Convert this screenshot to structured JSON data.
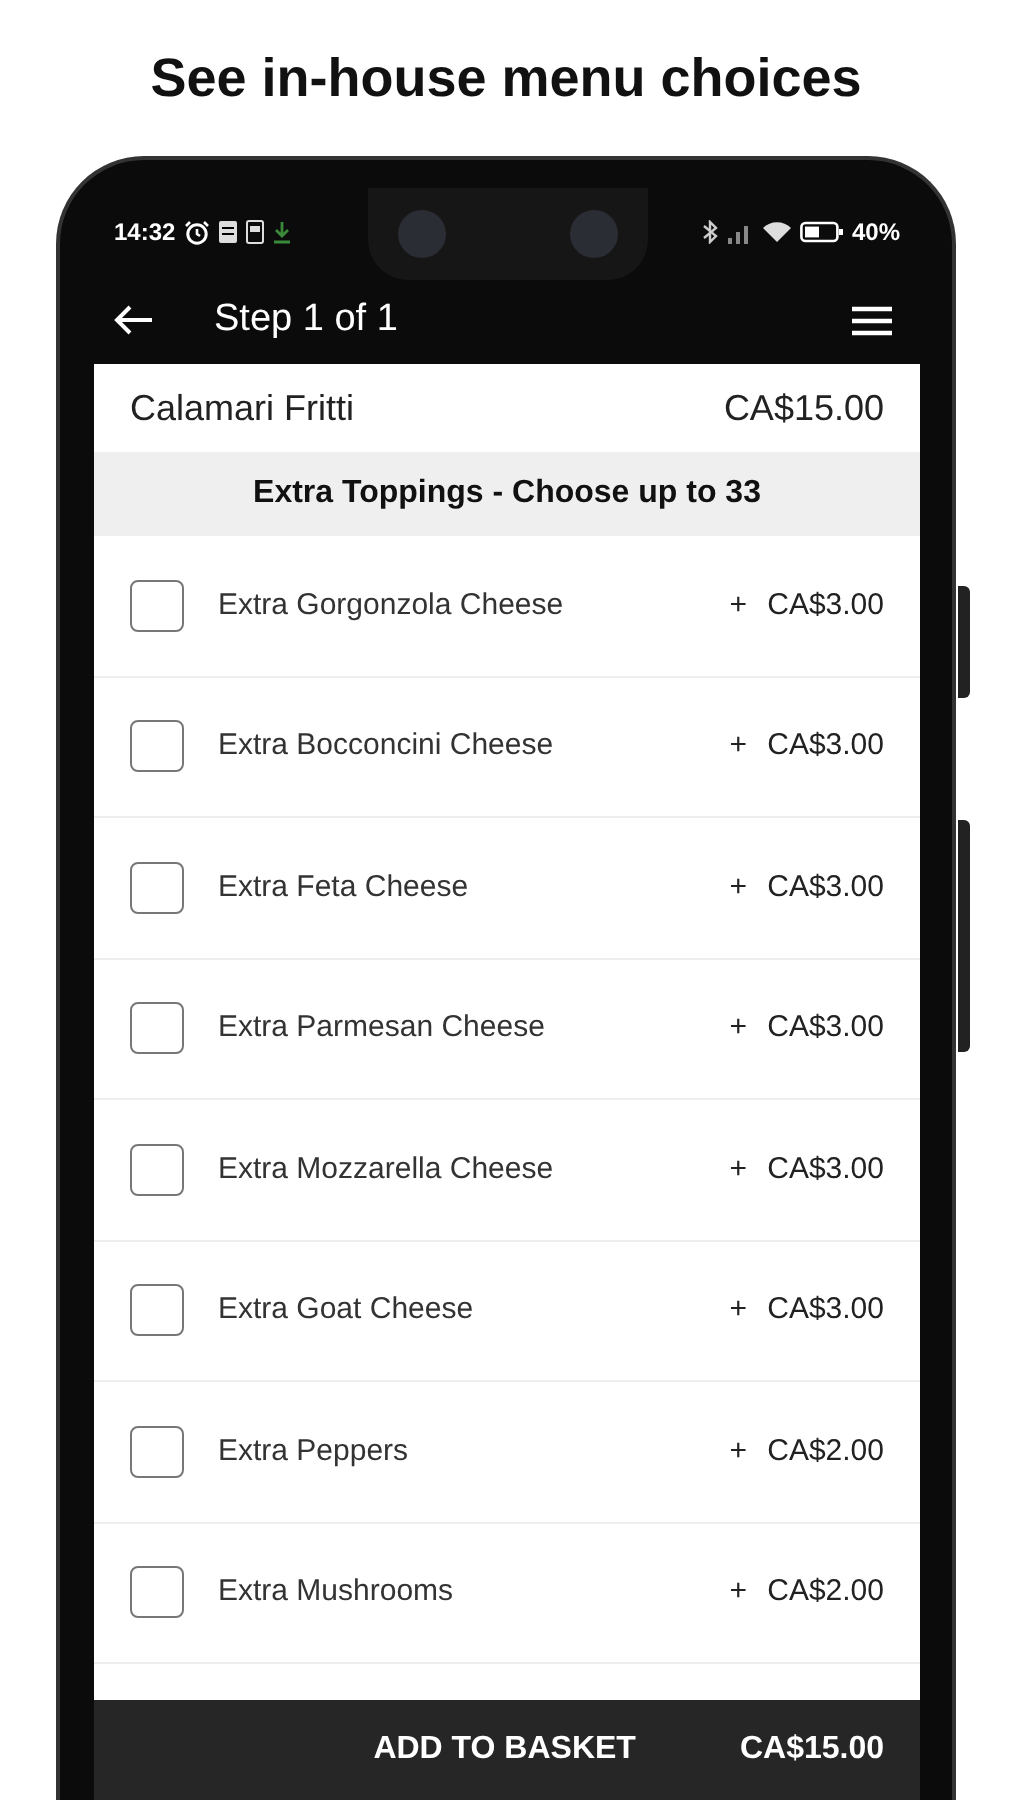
{
  "caption": "See in-house menu choices",
  "status_bar": {
    "time": "14:32",
    "battery": "40%"
  },
  "header": {
    "title": "Step 1 of 1"
  },
  "item": {
    "name": "Calamari Fritti",
    "price": "CA$15.00"
  },
  "section": {
    "title": "Extra Toppings - Choose up to 33"
  },
  "options": [
    {
      "label": "Extra Gorgonzola Cheese",
      "price": "+ CA$3.00",
      "checked": false
    },
    {
      "label": "Extra Bocconcini Cheese",
      "price": "+ CA$3.00",
      "checked": false
    },
    {
      "label": "Extra Feta Cheese",
      "price": "+ CA$3.00",
      "checked": false
    },
    {
      "label": "Extra Parmesan Cheese",
      "price": "+ CA$3.00",
      "checked": false
    },
    {
      "label": "Extra Mozzarella Cheese",
      "price": "+ CA$3.00",
      "checked": false
    },
    {
      "label": "Extra Goat Cheese",
      "price": "+ CA$3.00",
      "checked": false
    },
    {
      "label": "Extra Peppers",
      "price": "+ CA$2.00",
      "checked": false
    },
    {
      "label": "Extra Mushrooms",
      "price": "+ CA$2.00",
      "checked": false
    }
  ],
  "footer": {
    "button": "ADD TO BASKET",
    "total": "CA$15.00"
  }
}
